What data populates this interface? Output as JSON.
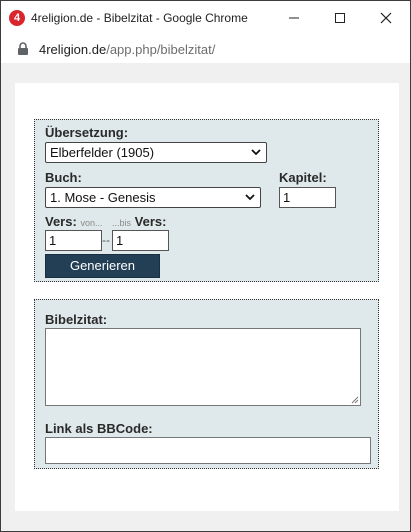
{
  "window": {
    "title": "4religion.de - Bibelzitat - Google Chrome",
    "logo_text": "4",
    "icons": [
      "minimize-icon",
      "maximize-icon",
      "close-icon"
    ]
  },
  "address": {
    "domain": "4religion.de",
    "path": "/app.php/bibelzitat/"
  },
  "form": {
    "translation_label": "Übersetzung:",
    "translation_value": "Elberfelder (1905)",
    "book_label": "Buch:",
    "book_value": "1. Mose - Genesis",
    "chapter_label": "Kapitel:",
    "chapter_value": "1",
    "verse_label": "Vers:",
    "from_hint": "von...",
    "to_hint": "...bis",
    "verse_label_to": "Vers:",
    "verse_from_value": "1",
    "verse_separator": "--",
    "verse_to_value": "1",
    "generate_label": "Generieren"
  },
  "output": {
    "quote_label": "Bibelzitat:",
    "quote_value": "",
    "bbcode_label": "Link als BBCode:",
    "bbcode_value": ""
  },
  "colors": {
    "fieldset_bg": "#dfe8ea",
    "button_bg": "#233f55",
    "logo_red": "#d9262c"
  }
}
